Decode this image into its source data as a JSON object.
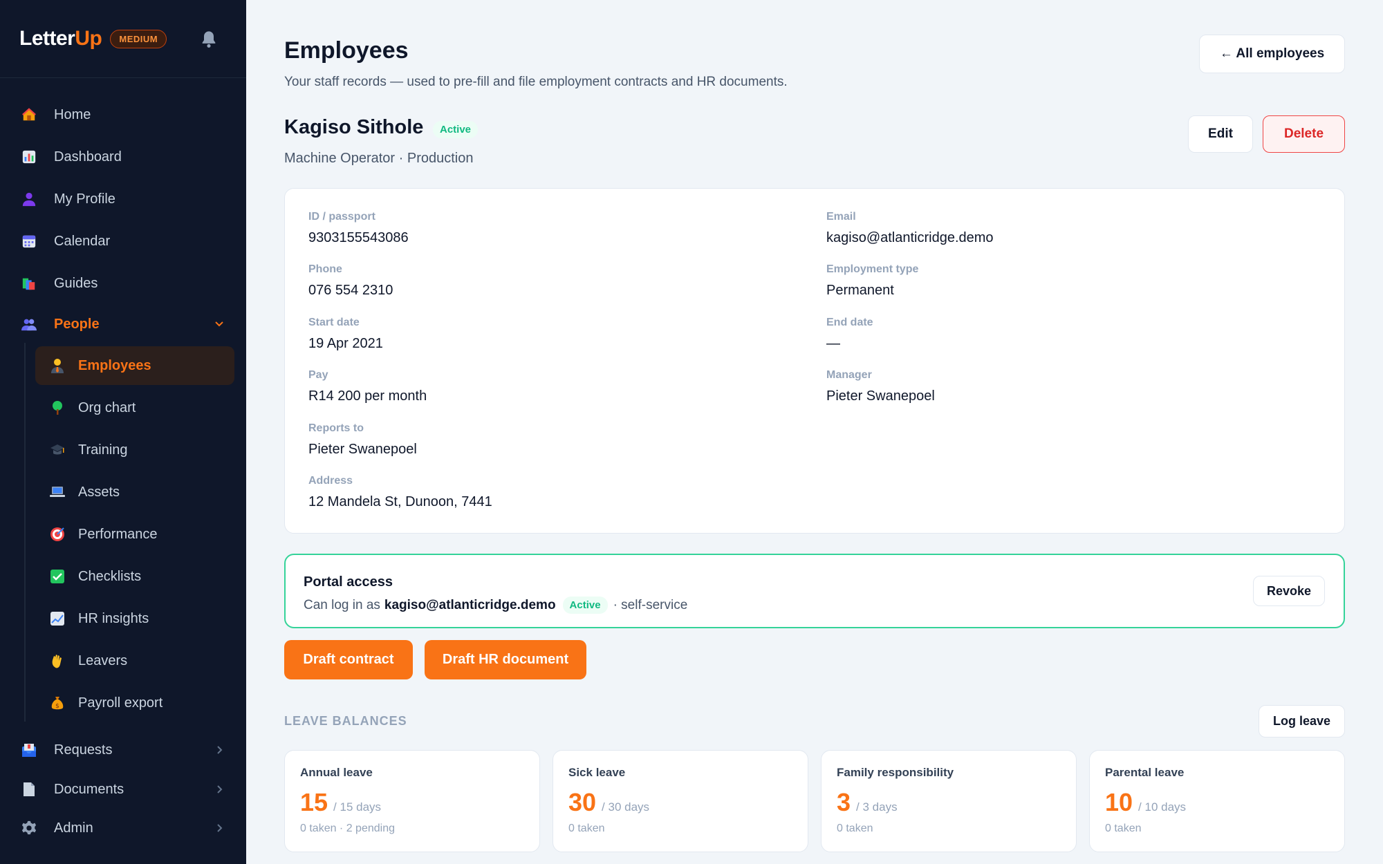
{
  "brand": {
    "name_part1": "Letter",
    "name_part2": "Up",
    "plan": "MEDIUM"
  },
  "sidebar": {
    "items": [
      {
        "label": "Home",
        "icon": "home-icon"
      },
      {
        "label": "Dashboard",
        "icon": "dashboard-icon"
      },
      {
        "label": "My Profile",
        "icon": "profile-icon"
      },
      {
        "label": "Calendar",
        "icon": "calendar-icon"
      },
      {
        "label": "Guides",
        "icon": "guides-icon"
      },
      {
        "label": "People",
        "icon": "people-icon"
      }
    ],
    "people_sub": [
      {
        "label": "Employees",
        "icon": "employee-icon"
      },
      {
        "label": "Org chart",
        "icon": "tree-icon"
      },
      {
        "label": "Training",
        "icon": "graduation-icon"
      },
      {
        "label": "Assets",
        "icon": "laptop-icon"
      },
      {
        "label": "Performance",
        "icon": "target-icon"
      },
      {
        "label": "Checklists",
        "icon": "checkbox-icon"
      },
      {
        "label": "HR insights",
        "icon": "chart-icon"
      },
      {
        "label": "Leavers",
        "icon": "wave-icon"
      },
      {
        "label": "Payroll export",
        "icon": "money-bag-icon"
      }
    ],
    "bottom": [
      {
        "label": "Requests",
        "icon": "inbox-icon"
      },
      {
        "label": "Documents",
        "icon": "document-icon"
      },
      {
        "label": "Admin",
        "icon": "gear-icon"
      }
    ]
  },
  "header": {
    "title": "Employees",
    "subtitle": "Your staff records — used to pre-fill and file employment contracts and HR documents.",
    "back_button": "← All employees"
  },
  "employee": {
    "name": "Kagiso Sithole",
    "status": "Active",
    "role_line": "Machine Operator · Production",
    "edit_label": "Edit",
    "delete_label": "Delete",
    "fields": {
      "id_label": "ID / passport",
      "id_value": "9303155543086",
      "email_label": "Email",
      "email_value": "kagiso@atlanticridge.demo",
      "phone_label": "Phone",
      "phone_value": "076 554 2310",
      "emptype_label": "Employment type",
      "emptype_value": "Permanent",
      "start_label": "Start date",
      "start_value": "19 Apr 2021",
      "end_label": "End date",
      "end_value": "—",
      "pay_label": "Pay",
      "pay_value": "R14 200 per month",
      "manager_label": "Manager",
      "manager_value": "Pieter Swanepoel",
      "reports_label": "Reports to",
      "reports_value": "Pieter Swanepoel",
      "address_label": "Address",
      "address_value": "12 Mandela St, Dunoon, 7441"
    }
  },
  "portal": {
    "title": "Portal access",
    "prefix": "Can log in as",
    "email": "kagiso@atlanticridge.demo",
    "status": "Active",
    "suffix": "· self-service",
    "revoke_label": "Revoke"
  },
  "actions": {
    "draft_contract": "Draft contract",
    "draft_hr_doc": "Draft HR document"
  },
  "leave": {
    "heading": "LEAVE BALANCES",
    "log_label": "Log leave",
    "cards": [
      {
        "title": "Annual leave",
        "remaining": "15",
        "total": "/ 15 days",
        "sub": "0 taken · 2 pending"
      },
      {
        "title": "Sick leave",
        "remaining": "30",
        "total": "/ 30 days",
        "sub": "0 taken"
      },
      {
        "title": "Family responsibility",
        "remaining": "3",
        "total": "/ 3 days",
        "sub": "0 taken"
      },
      {
        "title": "Parental leave",
        "remaining": "10",
        "total": "/ 10 days",
        "sub": "0 taken"
      }
    ]
  },
  "colors": {
    "accent": "#f97316",
    "sidebar_bg": "#0f172a",
    "success": "#10b981",
    "danger": "#dc2626"
  }
}
